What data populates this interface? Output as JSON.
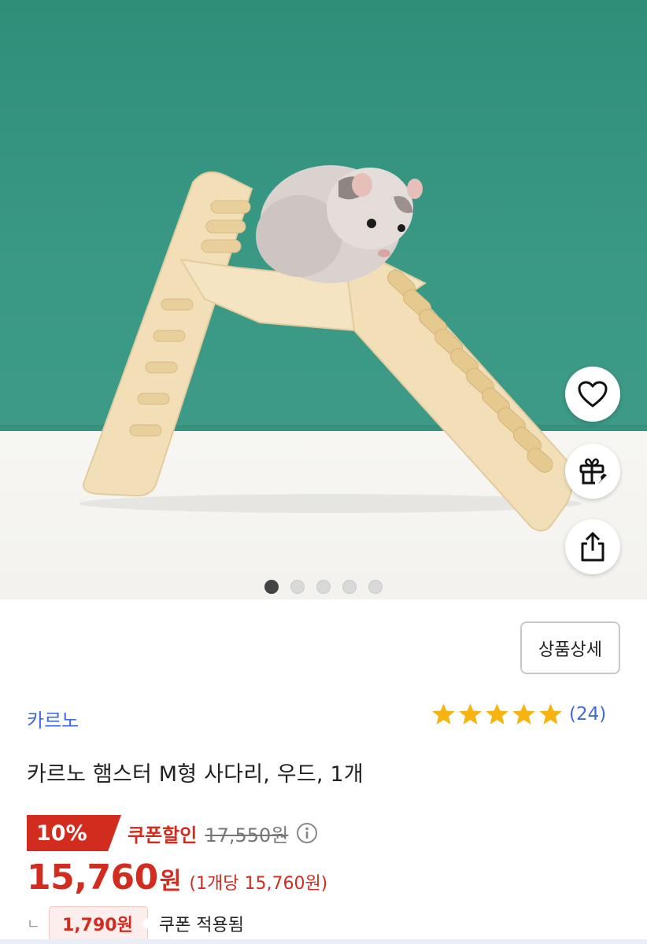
{
  "hero": {
    "image_alt": "hamster on wooden ladder",
    "carousel": {
      "total": 5,
      "active_index": 0
    },
    "actions": [
      {
        "name": "wishlist",
        "icon": "heart-icon"
      },
      {
        "name": "gift",
        "icon": "gift-icon"
      },
      {
        "name": "share",
        "icon": "share-icon"
      }
    ]
  },
  "product": {
    "detail_button": "상품상세",
    "brand": "카르노",
    "rating": {
      "stars": 5,
      "count_text": "(24)"
    },
    "title": "카르노 햄스터 M형 사다리, 우드, 1개",
    "price": {
      "discount_badge": "10%",
      "coupon_label": "쿠폰할인",
      "original_price": "17,550원",
      "sale_price": "15,760",
      "won": "원",
      "unit_price": "(1개당 15,760원)",
      "corner_glyph": "ㄴ",
      "coupon_amount": "1,790원",
      "coupon_applied": "쿠폰 적용됨"
    }
  },
  "colors": {
    "accent_red": "#d22c1f",
    "link_blue": "#3f6bd8",
    "star_gold": "#f6b40e",
    "wall_green": "#3a9985"
  }
}
